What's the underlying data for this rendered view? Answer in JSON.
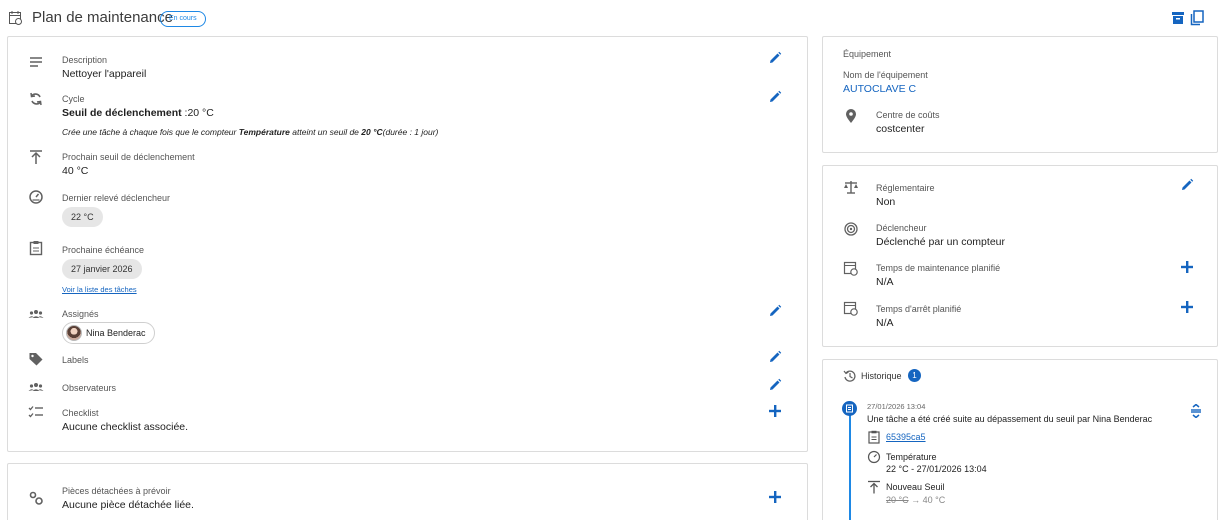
{
  "header": {
    "title": "Plan de maintenance",
    "status_badge": "En cours"
  },
  "main": {
    "description": {
      "label": "Description",
      "value": "Nettoyer l'appareil"
    },
    "cycle": {
      "label": "Cycle",
      "value_bold": "Seuil de déclenchement",
      "value_rest": " :20 °C",
      "note_pre": "Crée une tâche à chaque fois que le compteur ",
      "note_bold1": "Température",
      "note_mid": " atteint un seuil de ",
      "note_bold2": "20 °C",
      "note_post": "(durée : 1 jour)"
    },
    "next_threshold": {
      "label": "Prochain seuil de déclenchement",
      "value": "40 °C"
    },
    "last_reading": {
      "label": "Dernier relevé déclencheur",
      "chip": "22 °C"
    },
    "next_due": {
      "label": "Prochaine échéance",
      "chip": "27 janvier 2026",
      "link": "Voir la liste des tâches"
    },
    "assignees": {
      "label": "Assignés",
      "user": "Nina Benderac"
    },
    "labels": {
      "label": "Labels"
    },
    "observers": {
      "label": "Observateurs"
    },
    "checklist": {
      "label": "Checklist",
      "value": "Aucune checklist associée."
    }
  },
  "parts": {
    "label": "Pièces détachées à prévoir",
    "value": "Aucune pièce détachée liée."
  },
  "equipment": {
    "section_title": "Équipement",
    "name_label": "Nom de l'équipement",
    "name_value": "AUTOCLAVE C",
    "cost_center_label": "Centre de coûts",
    "cost_center_value": "costcenter"
  },
  "details": {
    "regulatory": {
      "label": "Réglementaire",
      "value": "Non"
    },
    "trigger": {
      "label": "Déclencheur",
      "value": "Déclenché par un compteur"
    },
    "planned_maintenance": {
      "label": "Temps de maintenance planifié",
      "value": "N/A"
    },
    "planned_downtime": {
      "label": "Temps d'arrêt planifié",
      "value": "N/A"
    }
  },
  "history": {
    "title": "Historique",
    "count": "1",
    "entry": {
      "timestamp": "27/01/2026 13:04",
      "text": "Une tâche a été créé suite au dépassement du seuil par Nina Benderac",
      "task_id": "65395ca5",
      "counter_name": "Température",
      "counter_value": "22 °C - 27/01/2026 13:04",
      "threshold_label": "Nouveau Seuil",
      "threshold_old": "20 °C",
      "threshold_arrow": " → ",
      "threshold_new": "40 °C"
    }
  },
  "colors": {
    "accent": "#1565c0",
    "link": "#1e88e5",
    "icon_gray": "#616161"
  }
}
